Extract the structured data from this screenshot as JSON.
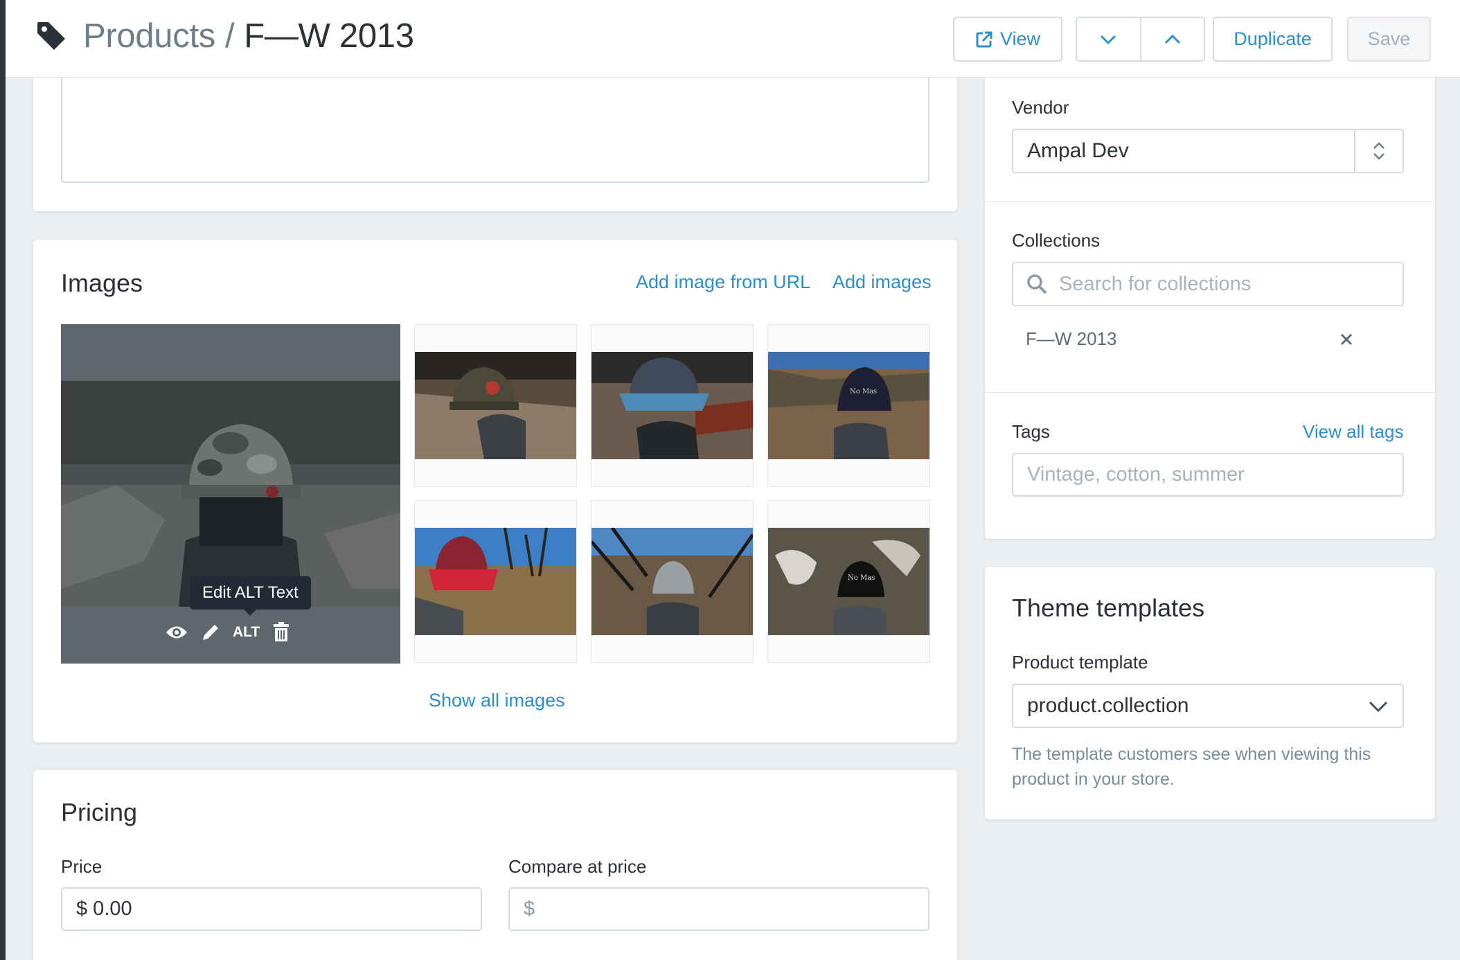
{
  "header": {
    "breadcrumb_parent": "Products",
    "breadcrumb_separator": "/",
    "title": "F—W 2013",
    "view_label": "View",
    "duplicate_label": "Duplicate",
    "save_label": "Save"
  },
  "images_card": {
    "title": "Images",
    "add_from_url": "Add image from URL",
    "add_images": "Add images",
    "tooltip": "Edit ALT Text",
    "alt_label": "ALT",
    "show_all": "Show all images"
  },
  "pricing": {
    "title": "Pricing",
    "price_label": "Price",
    "price_value": "$ 0.00",
    "compare_label": "Compare at price",
    "compare_placeholder": "$"
  },
  "organization": {
    "vendor_label": "Vendor",
    "vendor_value": "Ampal Dev",
    "collections_label": "Collections",
    "collections_placeholder": "Search for collections",
    "collections": [
      "F—W 2013"
    ],
    "tags_label": "Tags",
    "view_all_tags": "View all tags",
    "tags_placeholder": "Vintage, cotton, summer"
  },
  "theme": {
    "title": "Theme templates",
    "template_label": "Product template",
    "template_value": "product.collection",
    "help_text": "The template customers see when viewing this product in your store."
  },
  "colors": {
    "accent": "#2a8ed0",
    "sidebar": "#30373b",
    "background": "#ebeef0"
  },
  "icons": [
    "tag-icon",
    "external-link-icon",
    "chevron-down-icon",
    "chevron-up-icon",
    "eye-icon",
    "pencil-icon",
    "trash-icon",
    "search-icon",
    "close-icon",
    "select-stepper-icon"
  ]
}
